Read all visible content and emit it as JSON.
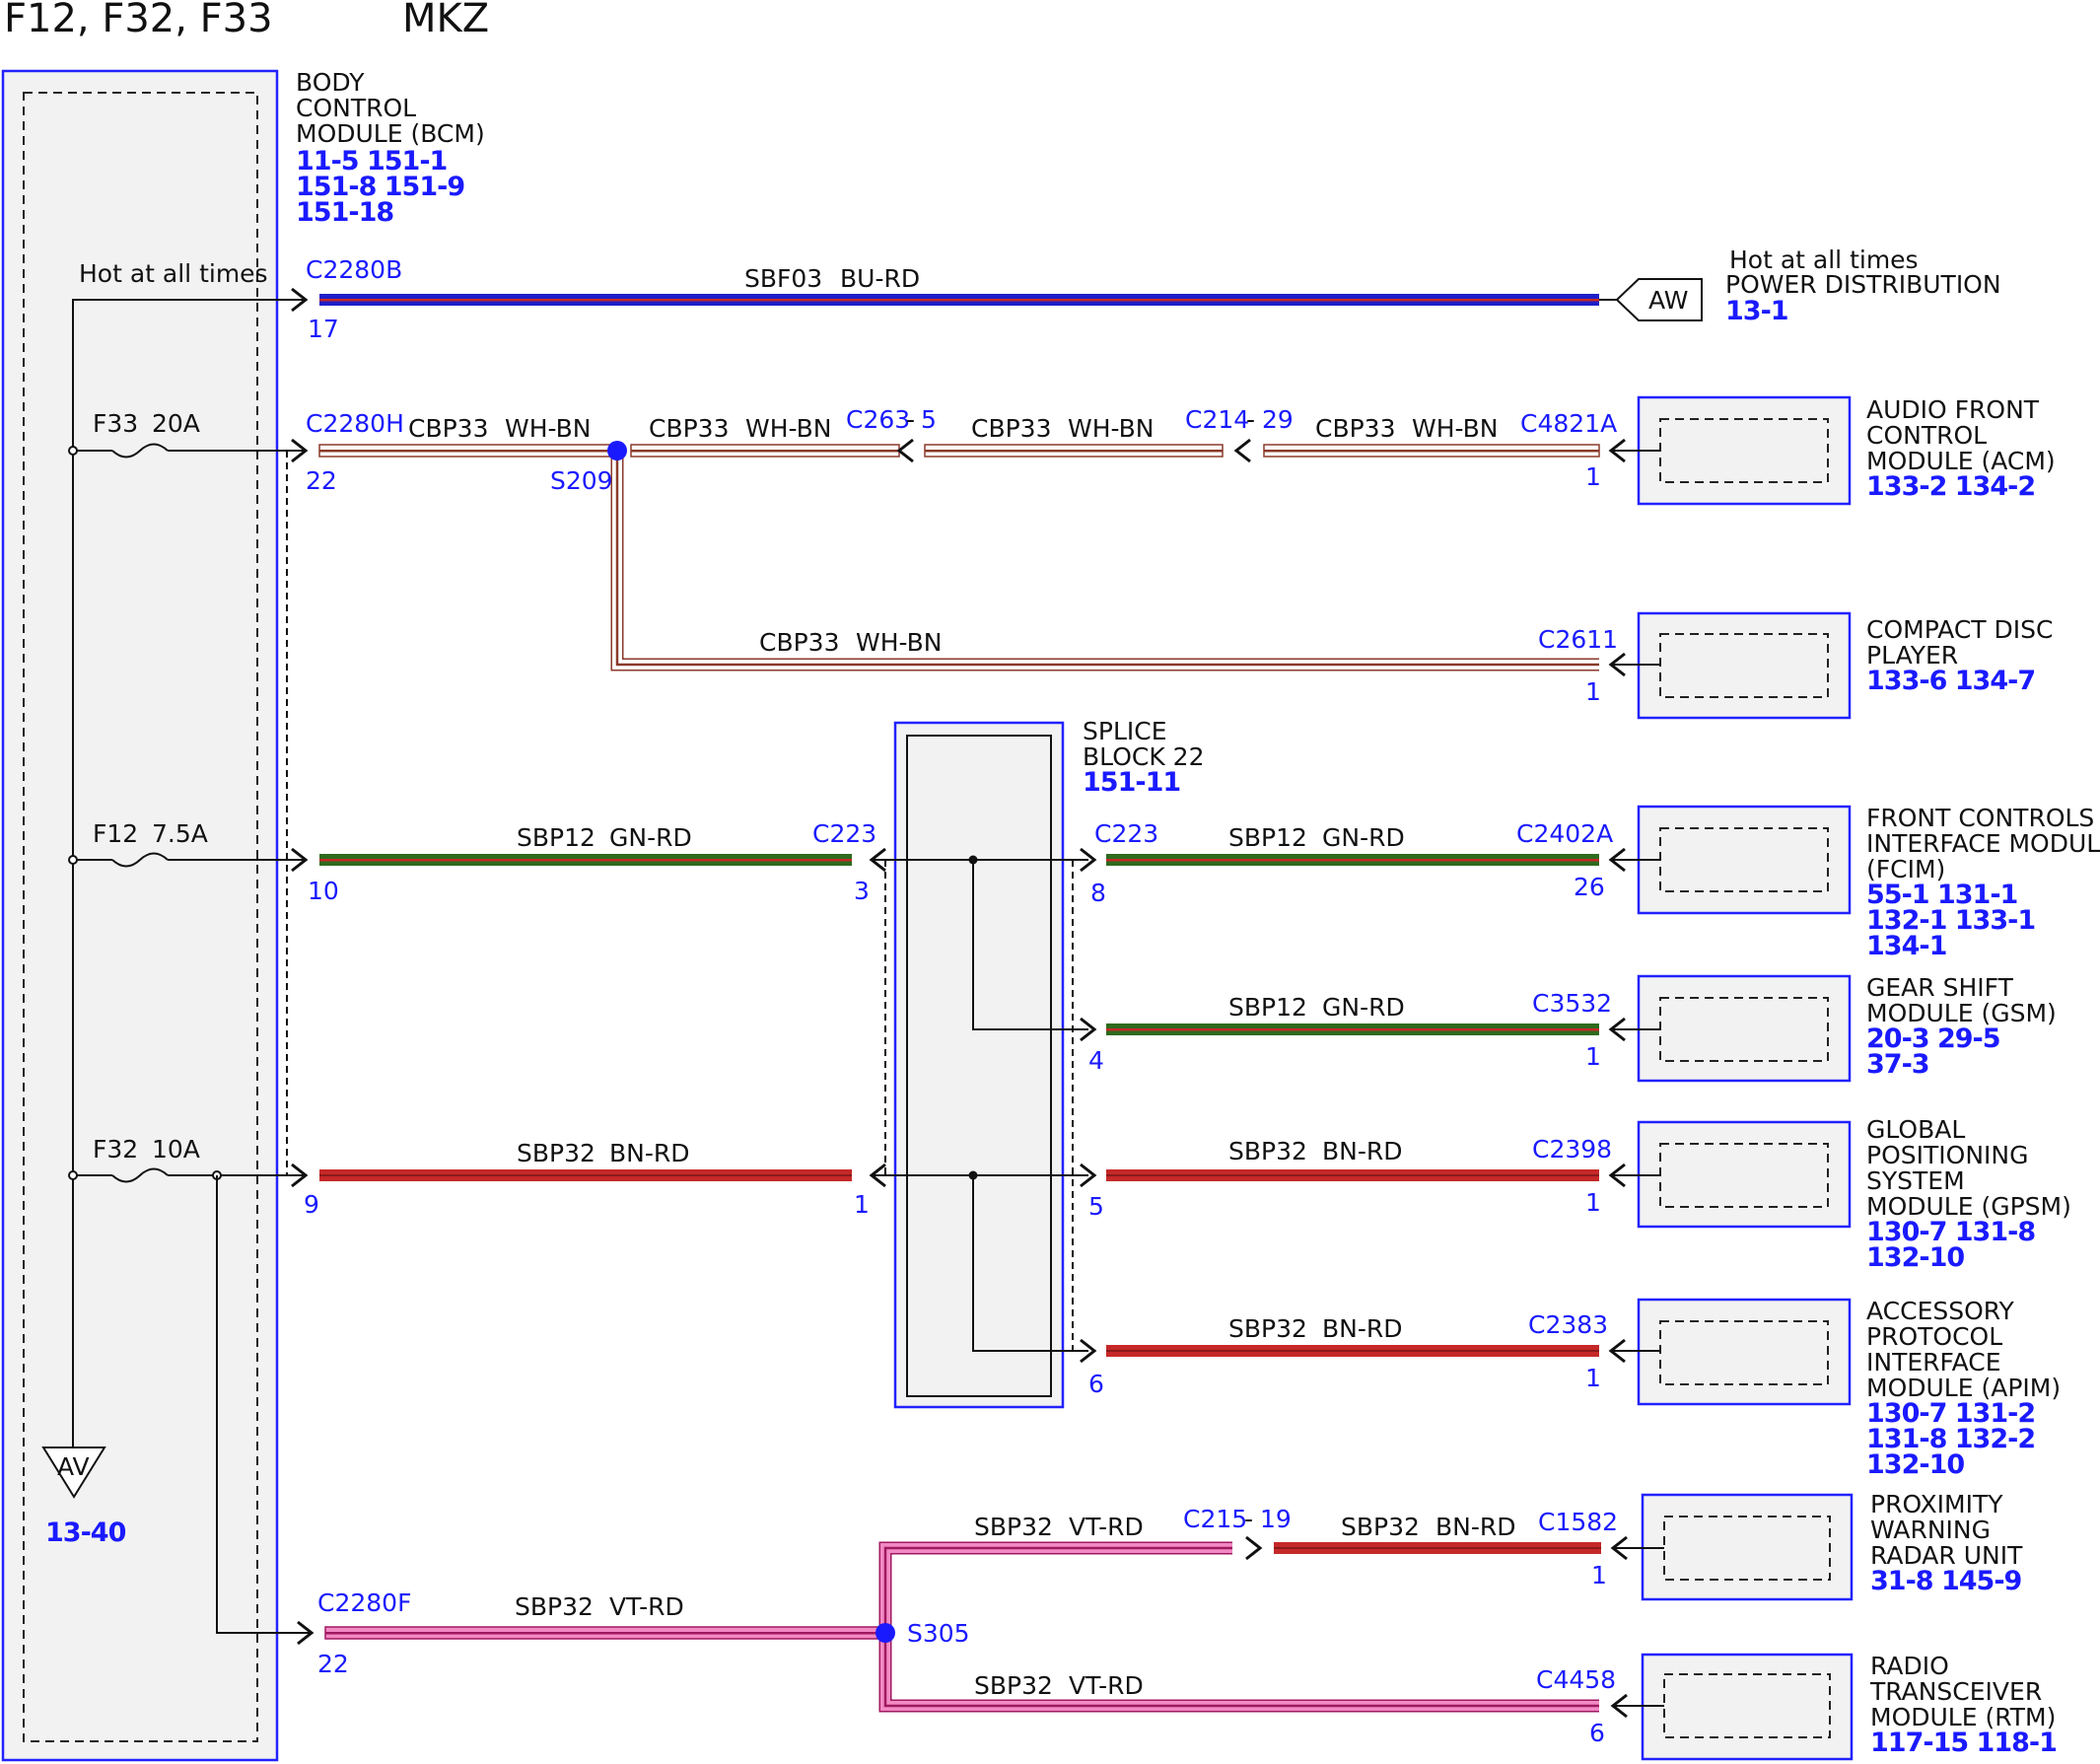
{
  "header": {
    "fuses": "F12, F32, F33",
    "model": "MKZ"
  },
  "bcm": {
    "name": [
      "BODY",
      "CONTROL",
      "MODULE (BCM)"
    ],
    "pages": [
      "11-5   151-1",
      "151-8 151-9",
      "151-18"
    ],
    "hot_label": "Hot at all times",
    "ground_ref": "AV",
    "ground_page": "13-40"
  },
  "fuses": [
    {
      "id": "F33",
      "rating": "20A"
    },
    {
      "id": "F12",
      "rating": "7.5A"
    },
    {
      "id": "F32",
      "rating": "10A"
    }
  ],
  "power": {
    "hot": "Hot at all times",
    "name": "POWER DISTRIBUTION",
    "ref": "AW",
    "page": "13-1"
  },
  "splice_block": {
    "name": [
      "SPLICE",
      "BLOCK 22"
    ],
    "page": "151-11"
  },
  "splices": [
    "S209",
    "S305"
  ],
  "connectors": {
    "c2280b": "C2280B",
    "c2280b_pin": "17",
    "c2280h": "C2280H",
    "c2280h_pin": "22",
    "c263": "C263",
    "c263_pin": "5",
    "c214": "C214",
    "c214_pin": "29",
    "c4821a": "C4821A",
    "c4821a_pin": "1",
    "c2611": "C2611",
    "c2611_pin": "1",
    "c223_l": "C223",
    "c223_l_pin": "3",
    "c223_r": "C223",
    "c223_r_pin": "8",
    "bcm_pin_10": "10",
    "bcm_pin_9": "9",
    "c223_l_pin1": "1",
    "sb_pin4": "4",
    "sb_pin5": "5",
    "sb_pin6": "6",
    "c2402a": "C2402A",
    "c2402a_pin": "26",
    "c3532": "C3532",
    "c3532_pin": "1",
    "c2398": "C2398",
    "c2398_pin": "1",
    "c2383": "C2383",
    "c2383_pin": "1",
    "c2280f": "C2280F",
    "c2280f_pin": "22",
    "c215": "C215",
    "c215_pin": "19",
    "c1582": "C1582",
    "c1582_pin": "1",
    "c4458": "C4458",
    "c4458_pin": "6"
  },
  "wires": {
    "sbf03": {
      "circuit": "SBF03",
      "color": "BU-RD"
    },
    "cbp33": {
      "circuit": "CBP33",
      "color": "WH-BN"
    },
    "sbp12": {
      "circuit": "SBP12",
      "color": "GN-RD"
    },
    "sbp32_bn": {
      "circuit": "SBP32",
      "color": "BN-RD"
    },
    "sbp32_vt": {
      "circuit": "SBP32",
      "color": "VT-RD"
    }
  },
  "modules": [
    {
      "name": [
        "AUDIO FRONT",
        "CONTROL",
        "MODULE (ACM)"
      ],
      "pages": [
        "133-2 134-2"
      ]
    },
    {
      "name": [
        "COMPACT DISC",
        "PLAYER"
      ],
      "pages": [
        "133-6 134-7"
      ]
    },
    {
      "name": [
        "FRONT CONTROLS",
        "INTERFACE MODULE",
        "(FCIM)"
      ],
      "pages": [
        "55-1   131-1",
        "132-1 133-1",
        "134-1"
      ]
    },
    {
      "name": [
        "GEAR SHIFT",
        "MODULE (GSM)"
      ],
      "pages": [
        "20-3   29-5",
        "37-3"
      ]
    },
    {
      "name": [
        "GLOBAL",
        "POSITIONING",
        "SYSTEM",
        "MODULE (GPSM)"
      ],
      "pages": [
        "130-7 131-8",
        "132-10"
      ]
    },
    {
      "name": [
        "ACCESSORY",
        "PROTOCOL",
        "INTERFACE",
        "MODULE (APIM)"
      ],
      "pages": [
        "130-7 131-2",
        "131-8 132-2",
        "132-10"
      ]
    },
    {
      "name": [
        "PROXIMITY",
        "WARNING",
        "RADAR UNIT"
      ],
      "pages": [
        "31-8   145-9"
      ]
    },
    {
      "name": [
        "RADIO",
        "TRANSCEIVER",
        "MODULE (RTM)"
      ],
      "pages": [
        "117-15 118-1"
      ]
    }
  ],
  "colors": {
    "accent_blue": "#1a1aff",
    "blue": "#1f1fc8",
    "red": "#c62828",
    "green": "#2e6b1e",
    "pink": "#f28ac4",
    "white": "#ffffff"
  }
}
